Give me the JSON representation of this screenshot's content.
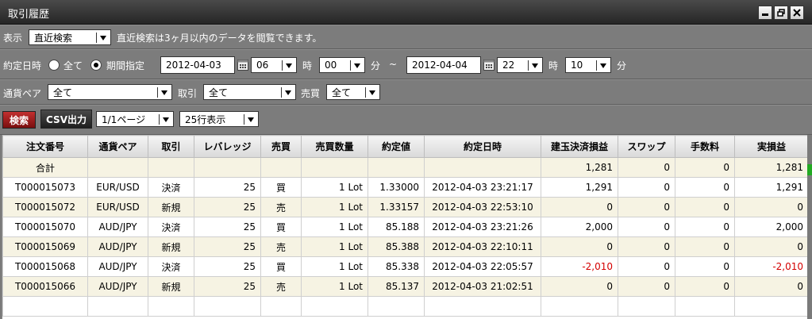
{
  "window": {
    "title": "取引履歴"
  },
  "filter1": {
    "display_label": "表示",
    "display_select": "直近検索",
    "note": "直近検索は3ヶ月以内のデータを閲覧できます。"
  },
  "filter2": {
    "label": "約定日時",
    "radio_all": "全て",
    "radio_period": "期間指定",
    "radio_selected": "period",
    "from_date": "2012-04-03",
    "from_hour": "06",
    "hour_unit": "時",
    "from_min": "00",
    "min_unit": "分",
    "tilde": "~",
    "to_date": "2012-04-04",
    "to_hour": "22",
    "to_min": "10"
  },
  "filter3": {
    "pair_label": "通貨ペア",
    "pair_select": "全て",
    "trade_label": "取引",
    "trade_select": "全て",
    "side_label": "売買",
    "side_select": "全て"
  },
  "toolbar": {
    "search_button": "検索",
    "csv_button": "CSV出力",
    "page_select": "1/1ページ",
    "rows_select": "25行表示"
  },
  "table": {
    "columns": [
      "注文番号",
      "通貨ペア",
      "取引",
      "レバレッジ",
      "売買",
      "売買数量",
      "約定値",
      "約定日時",
      "建玉決済損益",
      "スワップ",
      "手数料",
      "実損益"
    ],
    "total_row": [
      "合計",
      "",
      "",
      "",
      "",
      "",
      "",
      "",
      "1,281",
      "0",
      "0",
      "1,281"
    ],
    "rows": [
      [
        "T000015073",
        "EUR/USD",
        "決済",
        "25",
        "買",
        "1 Lot",
        "1.33000",
        "2012-04-03 23:21:17",
        "1,291",
        "0",
        "0",
        "1,291"
      ],
      [
        "T000015072",
        "EUR/USD",
        "新規",
        "25",
        "売",
        "1 Lot",
        "1.33157",
        "2012-04-03 22:53:10",
        "0",
        "0",
        "0",
        "0"
      ],
      [
        "T000015070",
        "AUD/JPY",
        "決済",
        "25",
        "買",
        "1 Lot",
        "85.188",
        "2012-04-03 23:21:26",
        "2,000",
        "0",
        "0",
        "2,000"
      ],
      [
        "T000015069",
        "AUD/JPY",
        "新規",
        "25",
        "売",
        "1 Lot",
        "85.388",
        "2012-04-03 22:10:11",
        "0",
        "0",
        "0",
        "0"
      ],
      [
        "T000015068",
        "AUD/JPY",
        "決済",
        "25",
        "買",
        "1 Lot",
        "85.338",
        "2012-04-03 22:05:57",
        "-2,010",
        "0",
        "0",
        "-2,010"
      ],
      [
        "T000015066",
        "AUD/JPY",
        "新規",
        "25",
        "売",
        "1 Lot",
        "85.137",
        "2012-04-03 21:02:51",
        "0",
        "0",
        "0",
        "0"
      ]
    ]
  },
  "colors": {
    "negative": "#d40000",
    "search_button": "#a01c1c",
    "alt_row": "#f6f3e3"
  }
}
